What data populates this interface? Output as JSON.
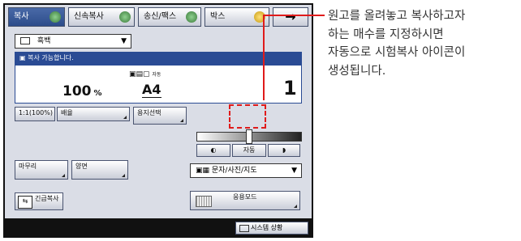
{
  "tabs": [
    {
      "label": "복사"
    },
    {
      "label": "신속복사"
    },
    {
      "label": "송신/팩스"
    },
    {
      "label": "박스"
    }
  ],
  "next_arrow": "→",
  "paper_select": {
    "value": "흑백"
  },
  "status_message": "복사 가능합니다.",
  "display": {
    "zoom": "100",
    "zoom_unit": "%",
    "paper_size": "A4",
    "paper_size_sub": "자동",
    "copies": "1"
  },
  "buttons": {
    "ratio_1to1": "1:1(100%)",
    "magnify": "배율",
    "paper_select": "용지선택",
    "density_light": "◐",
    "density_auto": "자동",
    "density_dark": "◗",
    "finishing": "마무리",
    "duplex": "양면",
    "text_photo_map": "문자/사진/지도",
    "rush_copy": "긴급복사",
    "special_mode": "응용모드",
    "system_status": "시스템 상황"
  },
  "callout": {
    "lines": [
      "원고를 올려놓고 복사하고자",
      "하는 매수를 지정하시면",
      "자동으로 시험복사 아이콘이",
      "생성됩니다."
    ]
  },
  "colors": {
    "accent_red": "#e01b1b",
    "status_blue": "#2a4b94",
    "panel_bg": "#dadde6"
  }
}
